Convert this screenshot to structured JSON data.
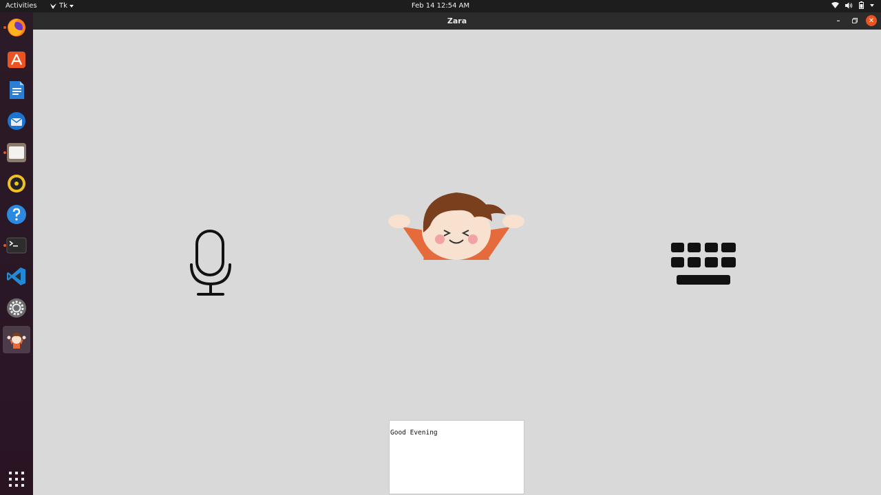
{
  "topbar": {
    "activities": "Activities",
    "app_menu": "Tk",
    "clock": "Feb 14  12:54 AM",
    "tray_icons": [
      "wifi-icon",
      "volume-icon",
      "battery-icon",
      "system-menu-icon"
    ]
  },
  "dock": {
    "items": [
      {
        "name": "firefox",
        "icon": "firefox-icon",
        "running": true
      },
      {
        "name": "ubuntu-software",
        "icon": "software-icon",
        "running": false
      },
      {
        "name": "libreoffice-writer",
        "icon": "writer-icon",
        "running": false
      },
      {
        "name": "thunderbird",
        "icon": "thunderbird-icon",
        "running": false
      },
      {
        "name": "files",
        "icon": "files-icon",
        "running": true
      },
      {
        "name": "rhythmbox",
        "icon": "rhythmbox-icon",
        "running": false
      },
      {
        "name": "help",
        "icon": "help-icon",
        "running": false
      },
      {
        "name": "terminal",
        "icon": "terminal-icon",
        "running": true
      },
      {
        "name": "vscode",
        "icon": "vscode-icon",
        "running": false
      },
      {
        "name": "settings",
        "icon": "settings-icon",
        "running": false
      },
      {
        "name": "zara",
        "icon": "zara-avatar-icon",
        "running": false,
        "active": true
      }
    ],
    "show_apps_icon": "app-grid-icon"
  },
  "window": {
    "title": "Zara",
    "controls": [
      "minimize",
      "maximize",
      "close"
    ]
  },
  "main": {
    "output_text": "Good Evening"
  },
  "colors": {
    "accent": "#e95420",
    "background": "#d9d9d9",
    "topbar": "#1d1d1d",
    "dock": "#2b1b27"
  }
}
